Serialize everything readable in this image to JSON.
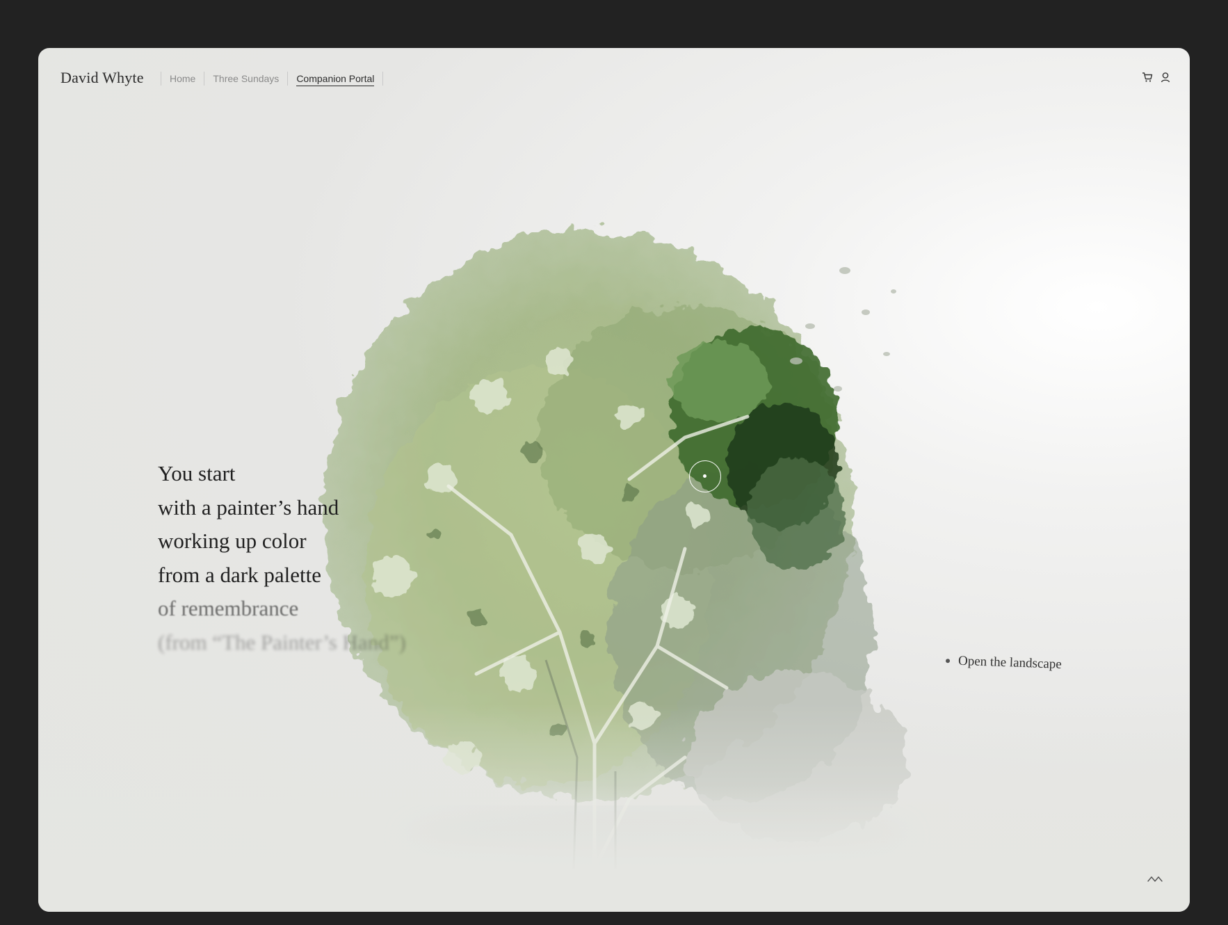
{
  "header": {
    "brand": "David Whyte",
    "nav": [
      {
        "label": "Home",
        "active": false
      },
      {
        "label": "Three Sundays",
        "active": false
      },
      {
        "label": "Companion Portal",
        "active": true
      }
    ],
    "icons": [
      "cart-icon",
      "user-icon"
    ]
  },
  "poem": {
    "lines": [
      "You start",
      "with a painter’s hand",
      "working up color",
      "from a dark palette",
      "of remembrance",
      "(from “The Painter’s Hand”)"
    ]
  },
  "cta": {
    "open_landscape": "Open the landscape"
  },
  "colors": {
    "background_outer": "#222222",
    "foliage_light": "#b9c994",
    "foliage_mid": "#8aa56a",
    "foliage_dark": "#2f4a26",
    "text": "#1f1f1f"
  },
  "icons": {
    "scroll_hint": "squiggle-icon",
    "cursor": "cursor-ring-icon"
  }
}
